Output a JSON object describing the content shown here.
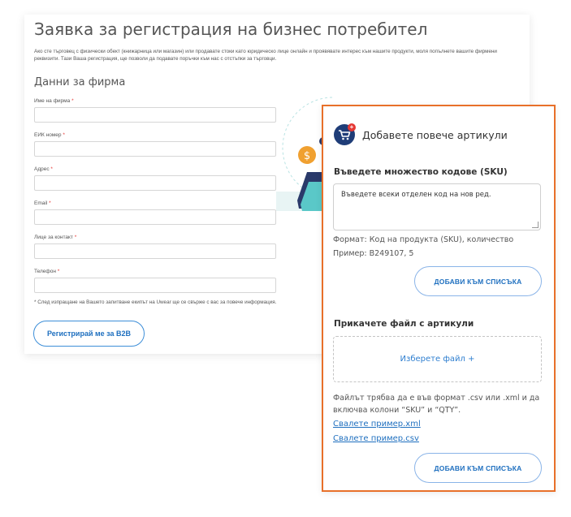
{
  "form": {
    "title": "Заявка за регистрация на бизнес потребител",
    "intro": "Ако сте търговец с физически обект (книжарница или магазин) или продавате стоки като юридическо лице онлайн и проявявате интерес към нашите продукти, моля попълнете вашите фирмени реквизити. Тази Ваша регистрация, ще позволи да подавате поръчки към нас с отстъпки за търговци.",
    "section_title": "Данни за фирма",
    "required_mark": "*",
    "fields": [
      {
        "label": "Име на фирма"
      },
      {
        "label": "ЕИК номер"
      },
      {
        "label": "Адрес"
      },
      {
        "label": "Email"
      },
      {
        "label": "Лице за контакт"
      },
      {
        "label": "Телефон"
      }
    ],
    "note": "* След изпращане на Вашето запитване екипът на Uwear ще се свърже с вас за повече информация.",
    "register_button": "Регистрирай ме за B2B"
  },
  "popup": {
    "title": "Добавете повече артикули",
    "sku_heading": "Въведете множество кодове (SKU)",
    "sku_placeholder": "Въведете всеки отделен код на нов ред.",
    "format_hint": "Формат: Код на продукта (SKU), количество",
    "example_hint": "Пример: B249107, 5",
    "add_button_1": "ДОБАВИ КЪМ СПИСЪКА",
    "attach_heading": "Прикачете файл с артикули",
    "choose_file": "Изберете файл +",
    "file_hint": "Файлът трябва да е във формат .csv или .xml и да включва колони “SKU” и “QTY”.",
    "download_xml": "Свалете пример.xml",
    "download_csv": "Свалете пример.csv",
    "add_button_2": "ДОБАВИ КЪМ СПИСЪКА"
  },
  "colors": {
    "accent_border": "#e8702a",
    "primary_blue": "#1e6fbf",
    "badge_navy": "#1f3d78",
    "required_red": "#e53935"
  }
}
